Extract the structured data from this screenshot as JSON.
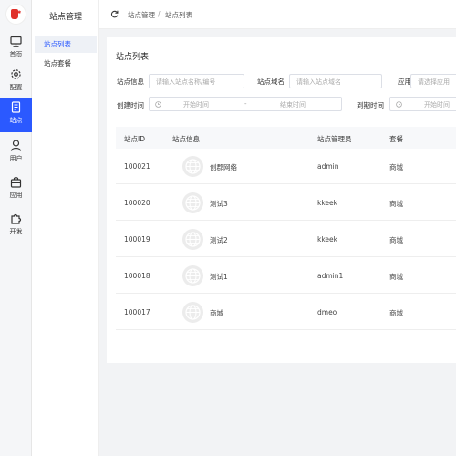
{
  "rail": {
    "items": [
      {
        "label": "首页",
        "icon": "monitor-icon"
      },
      {
        "label": "配置",
        "icon": "gear-icon"
      },
      {
        "label": "站点",
        "icon": "document-icon"
      },
      {
        "label": "用户",
        "icon": "user-icon"
      },
      {
        "label": "应用",
        "icon": "bag-icon"
      },
      {
        "label": "开发",
        "icon": "puzzle-icon"
      }
    ],
    "active": "站点",
    "accent": "#2b59ff"
  },
  "subnav": {
    "title": "站点管理",
    "items": [
      {
        "label": "站点列表"
      },
      {
        "label": "站点套餐"
      }
    ]
  },
  "breadcrumb": [
    "站点管理",
    "站点列表"
  ],
  "page": {
    "title": "站点列表"
  },
  "filters": {
    "site_info": {
      "label": "站点信息",
      "placeholder": "请输入站点名称/编号"
    },
    "site_domain": {
      "label": "站点域名",
      "placeholder": "请输入站点域名"
    },
    "app": {
      "label": "应用",
      "placeholder": "请选择应用"
    },
    "created": {
      "label": "创建时间",
      "start_placeholder": "开始时间",
      "separator": "-",
      "end_placeholder": "结束时间"
    },
    "expire": {
      "label": "到期时间",
      "start_placeholder": "开始时间"
    }
  },
  "table": {
    "columns": [
      "站点ID",
      "站点信息",
      "站点管理员",
      "套餐"
    ],
    "rows": [
      {
        "id": "100021",
        "name": "创郡网络",
        "admin": "admin",
        "plan": "商城"
      },
      {
        "id": "100020",
        "name": "测试3",
        "admin": "kkeek",
        "plan": "商城"
      },
      {
        "id": "100019",
        "name": "测试2",
        "admin": "kkeek",
        "plan": "商城"
      },
      {
        "id": "100018",
        "name": "测试1",
        "admin": "admin1",
        "plan": "商城"
      },
      {
        "id": "100017",
        "name": "商城",
        "admin": "dmeo",
        "plan": "商城"
      }
    ]
  }
}
